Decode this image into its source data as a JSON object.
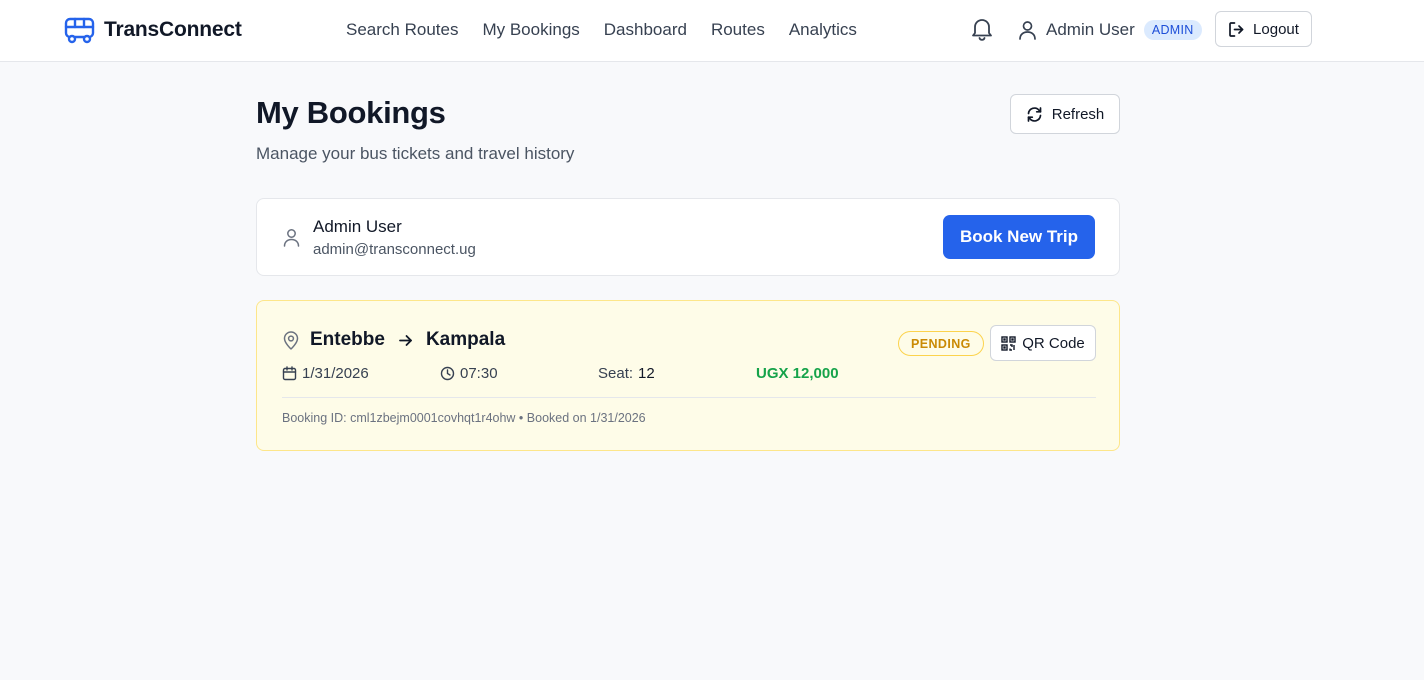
{
  "header": {
    "brand_name": "TransConnect",
    "brand_icon": "bus-icon",
    "nav": [
      {
        "label": "Search Routes"
      },
      {
        "label": "My Bookings"
      },
      {
        "label": "Dashboard"
      },
      {
        "label": "Routes"
      },
      {
        "label": "Analytics"
      }
    ],
    "notification_icon": "bell-icon",
    "user_name": "Admin User",
    "user_role": "ADMIN",
    "logout_label": "Logout"
  },
  "page": {
    "title": "My Bookings",
    "subtitle": "Manage your bus tickets and travel history",
    "refresh_label": "Refresh"
  },
  "user_card": {
    "name": "Admin User",
    "email": "admin@transconnect.ug",
    "book_label": "Book New Trip"
  },
  "bookings": [
    {
      "origin": "Entebbe",
      "destination": "Kampala",
      "date": "1/31/2026",
      "time": "07:30",
      "seat_label": "Seat:",
      "seat": "12",
      "price": "UGX 12,000",
      "status": "PENDING",
      "qr_label": "QR Code",
      "footer": "Booking ID: cml1zbejm0001covhqt1r4ohw • Booked on 1/31/2026"
    }
  ],
  "colors": {
    "primary": "#2563eb",
    "pending_text": "#ca8a04",
    "pending_bg": "#fefce8",
    "price": "#16a34a",
    "admin_badge_bg": "#dbeafe"
  }
}
